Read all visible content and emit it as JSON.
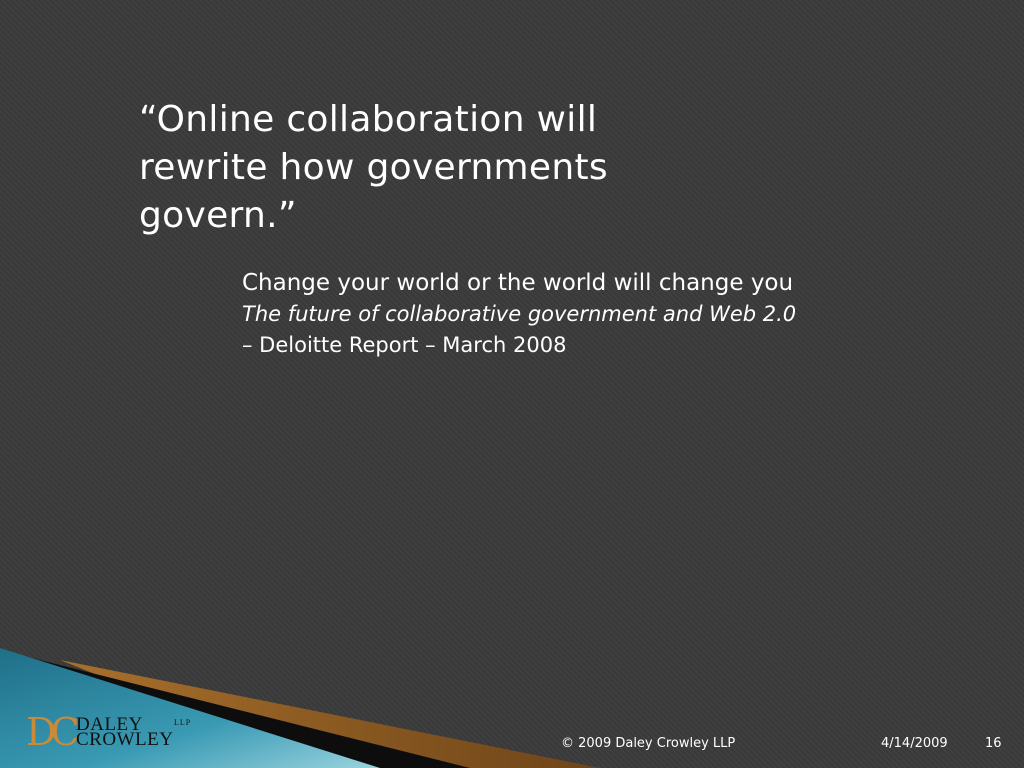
{
  "slide": {
    "quote": {
      "line1": "“Online collaboration will",
      "line2": "rewrite how governments",
      "line3": "govern.”"
    },
    "attribution": {
      "line1": "Change your world or the world will change you",
      "line2": "The future of collaborative government and Web 2.0",
      "line3": "– Deloitte Report – March 2008"
    },
    "logo": {
      "mark": "DC",
      "name1": "DALEY",
      "name2": "CROWLEY",
      "suffix": "LLP"
    },
    "footer": {
      "copyright": "© 2009 Daley Crowley LLP",
      "date": "4/14/2009",
      "page_number": "16"
    }
  },
  "colors": {
    "background": "#3a3a3a",
    "text": "#ffffff",
    "teal_swoosh": "#2a7f99",
    "bronze_swoosh": "#8c5a22",
    "logo_accent": "#c98a3a"
  }
}
